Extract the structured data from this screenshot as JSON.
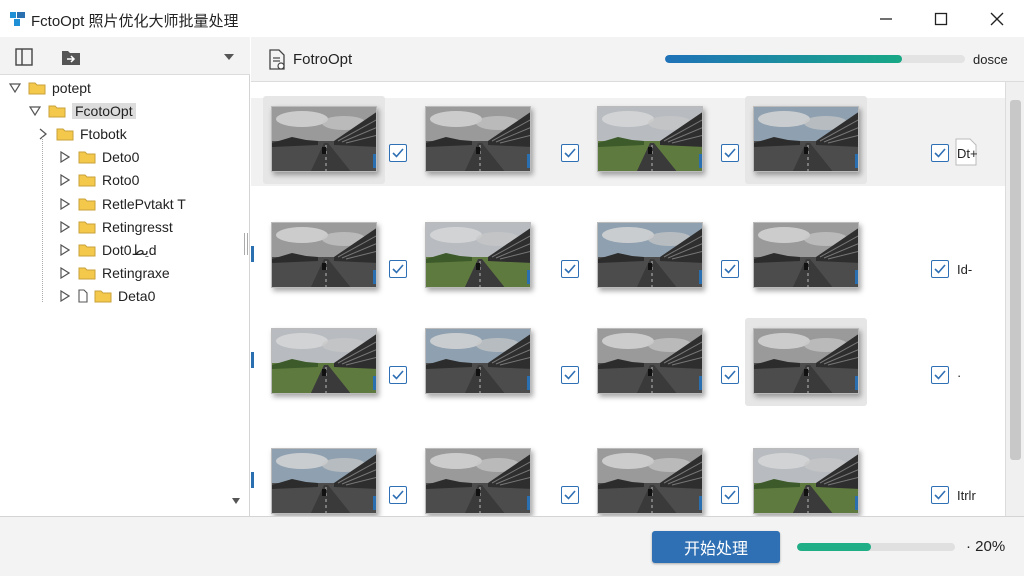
{
  "window": {
    "title": "FctoOpt 照片优化大师批量处理"
  },
  "tree": {
    "items": [
      {
        "label": "potept",
        "level": 0,
        "arrow": "down",
        "icon": "folder"
      },
      {
        "label": "FcotoOpt",
        "level": 1,
        "arrow": "down",
        "icon": "folder",
        "selected": true
      },
      {
        "label": "Ftobotk",
        "level": 2,
        "arrow": "right-small",
        "icon": "folder"
      },
      {
        "label": "Deto0",
        "level": 3,
        "arrow": "right",
        "icon": "folder"
      },
      {
        "label": "Roto0",
        "level": 3,
        "arrow": "right",
        "icon": "folder"
      },
      {
        "label": "RetlePvtakt T",
        "level": 3,
        "arrow": "right",
        "icon": "folder"
      },
      {
        "label": "Retingresst",
        "level": 3,
        "arrow": "right",
        "icon": "folder"
      },
      {
        "label": "Dotيط0d",
        "level": 3,
        "arrow": "right",
        "icon": "folder"
      },
      {
        "label": "Retingraxe",
        "level": 3,
        "arrow": "right",
        "icon": "folder"
      },
      {
        "label": "Deta0",
        "level": 3,
        "arrow": "right",
        "icon": "file-folder"
      }
    ]
  },
  "right_toolbar": {
    "title": "FotroOpt",
    "progress": 0.79,
    "label": "dosce"
  },
  "grid": {
    "rows": [
      {
        "side_label": "Dt+",
        "side_icon": true,
        "highlighted": [
          0,
          3
        ]
      },
      {
        "side_label": "Id-",
        "side_icon": false,
        "highlighted": []
      },
      {
        "side_label": "·",
        "side_icon": false,
        "highlighted": [
          3
        ]
      },
      {
        "side_label": "Itrlr",
        "side_icon": false,
        "highlighted": []
      }
    ],
    "checked": true
  },
  "bottom": {
    "start_label": "开始处理",
    "progress": 0.47,
    "percent_label": "· 20%"
  },
  "colors": {
    "accent": "#2f6fb3",
    "progress_green": "#1fae85",
    "folder": "#f3c84b"
  }
}
